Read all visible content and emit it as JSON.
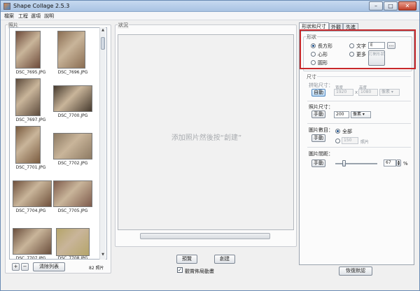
{
  "window": {
    "title": "Shape Collage 2.5.3"
  },
  "menu": [
    "檔案",
    "工程",
    "選項",
    "說明"
  ],
  "photos_panel": {
    "label": "照片",
    "items": [
      {
        "name": "DSC_7695.JPG",
        "color": "#6d4a3a"
      },
      {
        "name": "DSC_7696.JPG",
        "color": "#8a6d52"
      },
      {
        "name": "DSC_7697.JPG",
        "color": "#5d4b3c"
      },
      {
        "name": "DSC_7700.JPG",
        "color": "#463a2e"
      },
      {
        "name": "DSC_7701.JPG",
        "color": "#7a5b3f"
      },
      {
        "name": "DSC_7702.JPG",
        "color": "#8d7a63"
      },
      {
        "name": "DSC_7704.JPG",
        "color": "#70513c"
      },
      {
        "name": "DSC_7705.JPG",
        "color": "#7e5b4c"
      },
      {
        "name": "DSC_7707.JPG",
        "color": "#6b4f3d"
      },
      {
        "name": "DSC_7708.JPG",
        "color": "#b5a56a"
      }
    ],
    "add_label": "+",
    "remove_label": "−",
    "clear_label": "清除列表",
    "count": "82 照片"
  },
  "preview_panel": {
    "label": "狀況",
    "canvas_text": "添加照片然後按“創建”",
    "preview_label": "預覽",
    "create_label": "創建",
    "animate_label": "觀賞佈局動畫",
    "animate_checked": true
  },
  "tabs": [
    "形狀和尺寸",
    "外觀",
    "先進"
  ],
  "shape": {
    "label": "形狀",
    "rectangle": "長方形",
    "heart": "心形",
    "circle": "圓形",
    "text": "文字",
    "text_value": "E",
    "more": "更多",
    "custom_shape": "打開形狀"
  },
  "size": {
    "label": "尺寸",
    "collage_size_label": "拼貼尺寸：",
    "auto_label": "自動",
    "width_label": "寬度",
    "height_label": "高度",
    "width_value": "1920",
    "times": "x",
    "height_value": "1080",
    "unit": "像素",
    "photo_size_label": "照片尺寸：",
    "manual_label": "手動",
    "photo_size_value": "200",
    "photo_unit": "像素",
    "photo_count_label": "圖片數目：",
    "photo_count_manual": "手動",
    "all_label": "全部",
    "count_value": "150",
    "count_unit": "照片",
    "spacing_label": "圖片間距：",
    "spacing_manual": "手動",
    "spacing_value": "67",
    "spacing_unit": "%",
    "spacing_level": 0.2
  },
  "restore_label": "恢復默認"
}
